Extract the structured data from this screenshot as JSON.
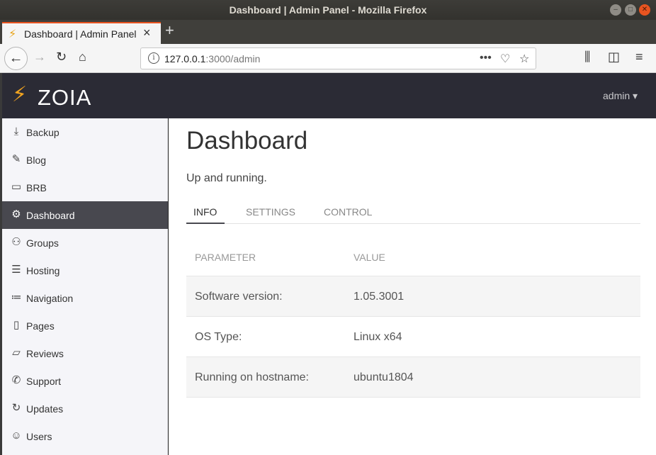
{
  "window": {
    "title": "Dashboard | Admin Panel - Mozilla Firefox"
  },
  "browser": {
    "tab_label": "Dashboard | Admin Panel",
    "url_host": "127.0.0.1",
    "url_rest": ":3000/admin",
    "icons": [
      "back-icon",
      "forward-icon",
      "reload-icon",
      "home-icon",
      "info-icon",
      "page-actions-icon",
      "pocket-icon",
      "bookmark-star-icon",
      "library-icon",
      "sidebar-icon",
      "menu-icon"
    ]
  },
  "header": {
    "logo_text": "ZOIA",
    "user_menu": "admin ▾",
    "accent_color": "#f0a320"
  },
  "sidebar": {
    "items": [
      {
        "label": "Backup",
        "icon": "backup-icon"
      },
      {
        "label": "Blog",
        "icon": "pencil-icon"
      },
      {
        "label": "BRB",
        "icon": "card-icon"
      },
      {
        "label": "Dashboard",
        "icon": "gear-icon",
        "active": true
      },
      {
        "label": "Groups",
        "icon": "users-icon"
      },
      {
        "label": "Hosting",
        "icon": "server-icon"
      },
      {
        "label": "Navigation",
        "icon": "list-icon"
      },
      {
        "label": "Pages",
        "icon": "page-icon"
      },
      {
        "label": "Reviews",
        "icon": "comment-icon"
      },
      {
        "label": "Support",
        "icon": "phone-icon"
      },
      {
        "label": "Updates",
        "icon": "refresh-icon"
      },
      {
        "label": "Users",
        "icon": "user-icon"
      }
    ]
  },
  "main": {
    "title": "Dashboard",
    "subtitle": "Up and running.",
    "tabs": [
      {
        "label": "INFO",
        "active": true
      },
      {
        "label": "SETTINGS"
      },
      {
        "label": "CONTROL"
      }
    ],
    "table": {
      "headers": [
        "PARAMETER",
        "VALUE"
      ],
      "rows": [
        [
          "Software version:",
          "1.05.3001"
        ],
        [
          "OS Type:",
          "Linux x64"
        ],
        [
          "Running on hostname:",
          "ubuntu1804"
        ]
      ]
    }
  }
}
